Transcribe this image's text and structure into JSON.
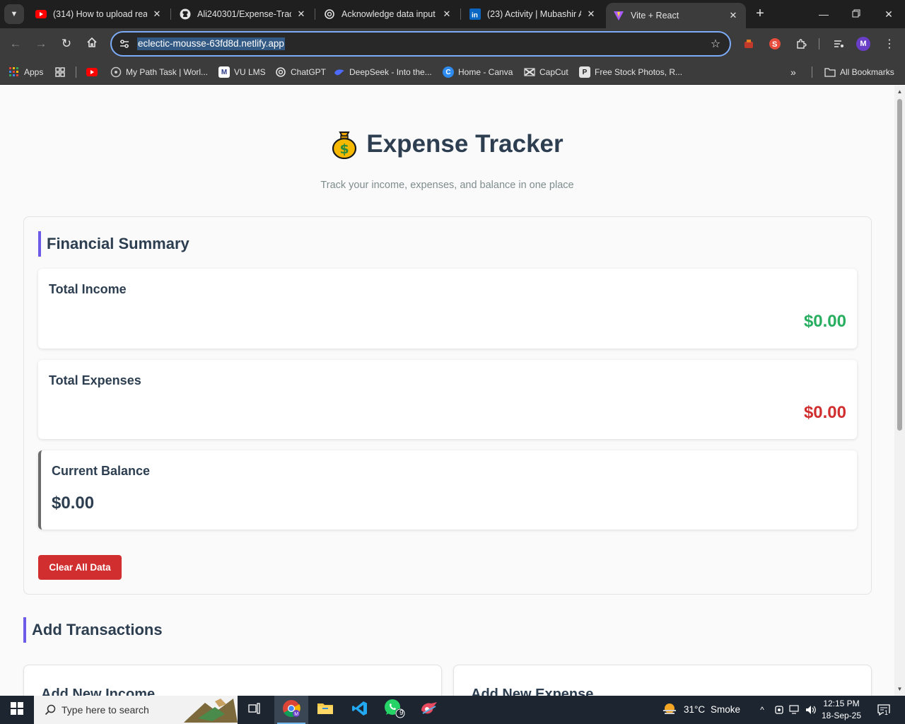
{
  "browser": {
    "tabs": [
      {
        "title": "(314) How to upload reac",
        "icon": "youtube-icon"
      },
      {
        "title": "Ali240301/Expense-Tracke",
        "icon": "github-icon"
      },
      {
        "title": "Acknowledge data input",
        "icon": "chatgpt-icon"
      },
      {
        "title": "(23) Activity | Mubashir A",
        "icon": "linkedin-icon"
      },
      {
        "title": "Vite + React",
        "icon": "vite-icon",
        "active": true
      }
    ],
    "url": "eclectic-mousse-63fd8d.netlify.app",
    "profile_initial": "M",
    "bookmarks": {
      "apps": "Apps",
      "items": [
        {
          "label": "My Path Task | Worl..."
        },
        {
          "label": "VU LMS"
        },
        {
          "label": "ChatGPT"
        },
        {
          "label": "DeepSeek - Into the..."
        },
        {
          "label": "Home - Canva"
        },
        {
          "label": "CapCut"
        },
        {
          "label": "Free Stock Photos, R..."
        }
      ],
      "all_bookmarks": "All Bookmarks"
    }
  },
  "page": {
    "title": "Expense Tracker",
    "subtitle": "Track your income, expenses, and balance in one place",
    "summary": {
      "heading": "Financial Summary",
      "income": {
        "label": "Total Income",
        "amount": "$0.00",
        "color": "#27ae60"
      },
      "expenses": {
        "label": "Total Expenses",
        "amount": "$0.00",
        "color": "#d12f2f"
      },
      "balance": {
        "label": "Current Balance",
        "amount": "$0.00"
      },
      "clear_button": "Clear All Data"
    },
    "transactions": {
      "heading": "Add Transactions",
      "income_form_title": "Add New Income",
      "expense_form_title": "Add New Expense"
    }
  },
  "taskbar": {
    "search_placeholder": "Type here to search",
    "weather_temp": "31°C",
    "weather_desc": "Smoke",
    "time": "12:15 PM",
    "date": "18-Sep-25",
    "whatsapp_badge": "9",
    "notification_count": "1"
  },
  "colors": {
    "accent": "#6c5ce7",
    "danger": "#d12f2f",
    "success": "#27ae60",
    "heading": "#2c3e50"
  }
}
